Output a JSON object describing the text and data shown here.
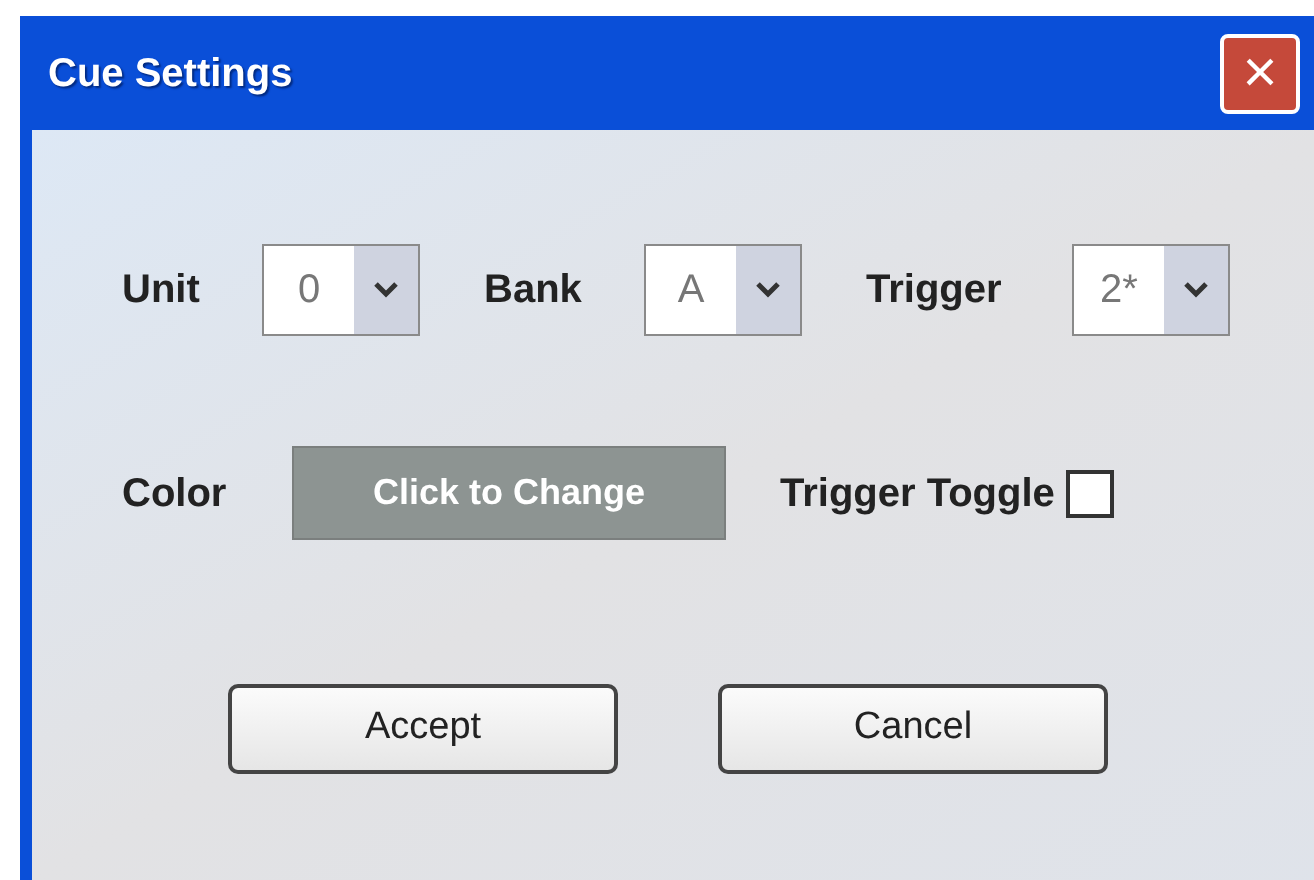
{
  "window": {
    "title": "Cue Settings",
    "close": "×"
  },
  "selects": [
    {
      "label": "Unit",
      "value": "0"
    },
    {
      "label": "Bank",
      "value": "A"
    },
    {
      "label": "Trigger",
      "value": "2*"
    }
  ],
  "color": {
    "label": "Color",
    "button": "Click to Change"
  },
  "trigger_toggle": {
    "label": "Trigger Toggle",
    "checked": false
  },
  "buttons": [
    "Accept",
    "Cancel"
  ]
}
